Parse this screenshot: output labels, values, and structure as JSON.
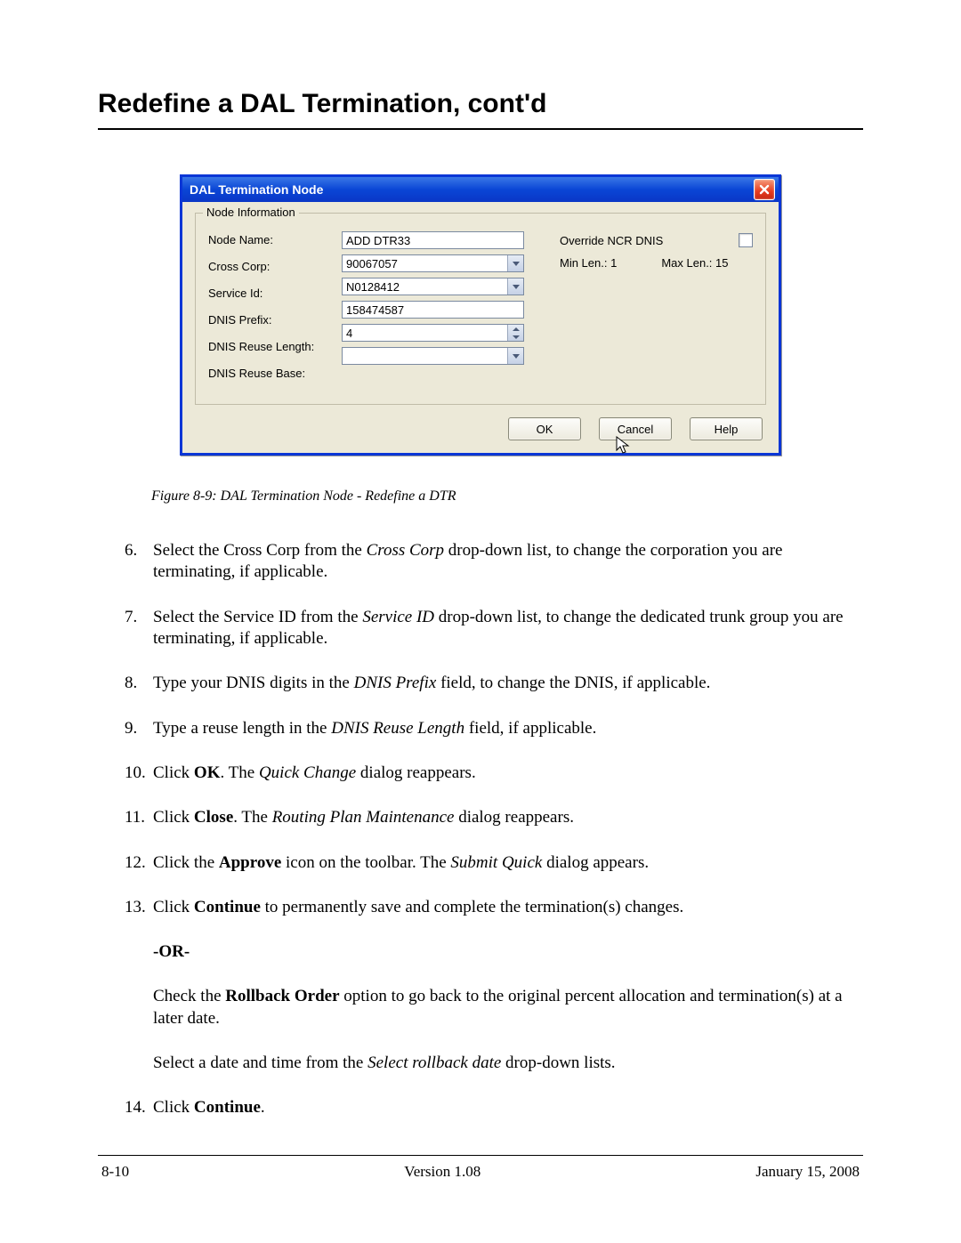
{
  "page": {
    "title": "Redefine a DAL Termination, cont'd",
    "footer_left": "8-10",
    "footer_center": "Version 1.08",
    "footer_right": "January 15, 2008"
  },
  "dialog": {
    "title": "DAL Termination Node",
    "groupbox_title": "Node Information",
    "labels": {
      "node_name": "Node Name:",
      "cross_corp": "Cross Corp:",
      "service_id": "Service Id:",
      "dnis_prefix": "DNIS Prefix:",
      "dnis_reuse_len": "DNIS Reuse Length:",
      "dnis_reuse_base": "DNIS Reuse Base:",
      "override": "Override NCR DNIS",
      "min_len": "Min Len.: 1",
      "max_len": "Max Len.: 15"
    },
    "values": {
      "node_name": "ADD DTR33",
      "cross_corp": "90067057",
      "service_id": "N0128412",
      "dnis_prefix": "158474587",
      "dnis_reuse_len": "4",
      "dnis_reuse_base": ""
    },
    "buttons": {
      "ok": "OK",
      "cancel": "Cancel",
      "help": "Help"
    }
  },
  "caption": "Figure 8-9:   DAL Termination Node - Redefine a DTR",
  "steps": {
    "s6a": "Select the Cross Corp from the ",
    "s6i": "Cross Corp",
    "s6b": " drop-down list, to change the corporation you are terminating, if applicable.",
    "s7a": "Select the Service ID from the ",
    "s7i": "Service ID",
    "s7b": " drop-down list, to change the dedicated trunk group you are terminating, if applicable.",
    "s8a": "Type your DNIS digits in the ",
    "s8i": "DNIS Prefix",
    "s8b": " field, to change the DNIS, if applicable.",
    "s9a": "Type a reuse length in the ",
    "s9i": "DNIS Reuse Length",
    "s9b": " field, if applicable.",
    "s10a": "Click ",
    "s10b": "OK",
    "s10c": ". The ",
    "s10i": "Quick Change",
    "s10d": " dialog reappears.",
    "s11a": "Click ",
    "s11b": "Close",
    "s11c": ". The ",
    "s11i": "Routing Plan Maintenance",
    "s11d": " dialog reappears.",
    "s12a": "Click the ",
    "s12b": "Approve",
    "s12c": " icon on the toolbar. The ",
    "s12i": "Submit Quick",
    "s12d": " dialog appears.",
    "s13a": "Click ",
    "s13b": "Continue",
    "s13c": " to permanently save and complete the termination(s) changes.",
    "or": "-OR-",
    "rb1a": "Check the ",
    "rb1b": "Rollback Order",
    "rb1c": " option to go back to the original percent allocation and termination(s) at a later date.",
    "rb2a": "Select a date and time from the ",
    "rb2i": "Select rollback date",
    "rb2b": " drop-down lists.",
    "s14a": "Click ",
    "s14b": "Continue",
    "s14c": "."
  }
}
